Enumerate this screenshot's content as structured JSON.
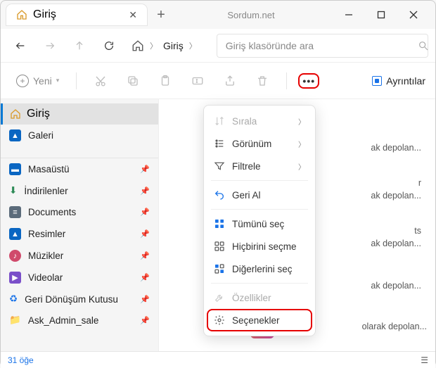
{
  "titlebar": {
    "tab_title": "Giriş",
    "brand": "Sordum.net"
  },
  "nav": {
    "breadcrumb": "Giriş",
    "search_placeholder": "Giriş klasöründe ara"
  },
  "cmdbar": {
    "new_label": "Yeni",
    "details_label": "Ayrıntılar"
  },
  "sidebar": {
    "home": "Giriş",
    "gallery": "Galeri",
    "pinned": [
      "Masaüstü",
      "İndirilenler",
      "Documents",
      "Resimler",
      "Müzikler",
      "Videolar",
      "Geri Dönüşüm Kutusu",
      "Ask_Admin_sale"
    ]
  },
  "content_fragments": {
    "f1": "ak depolan...",
    "f2": "r",
    "f3": "ak depolan...",
    "f4": "ts",
    "f5": "ak depolan...",
    "f6": "ak depolan...",
    "f7": "olarak depolan..."
  },
  "menu": {
    "sort": "Sırala",
    "view": "Görünüm",
    "filter": "Filtrele",
    "undo": "Geri Al",
    "select_all": "Tümünü seç",
    "select_none": "Hiçbirini seçme",
    "select_others": "Diğerlerini seç",
    "properties": "Özellikler",
    "options": "Seçenekler"
  },
  "footer": {
    "count": "31 öğe"
  }
}
